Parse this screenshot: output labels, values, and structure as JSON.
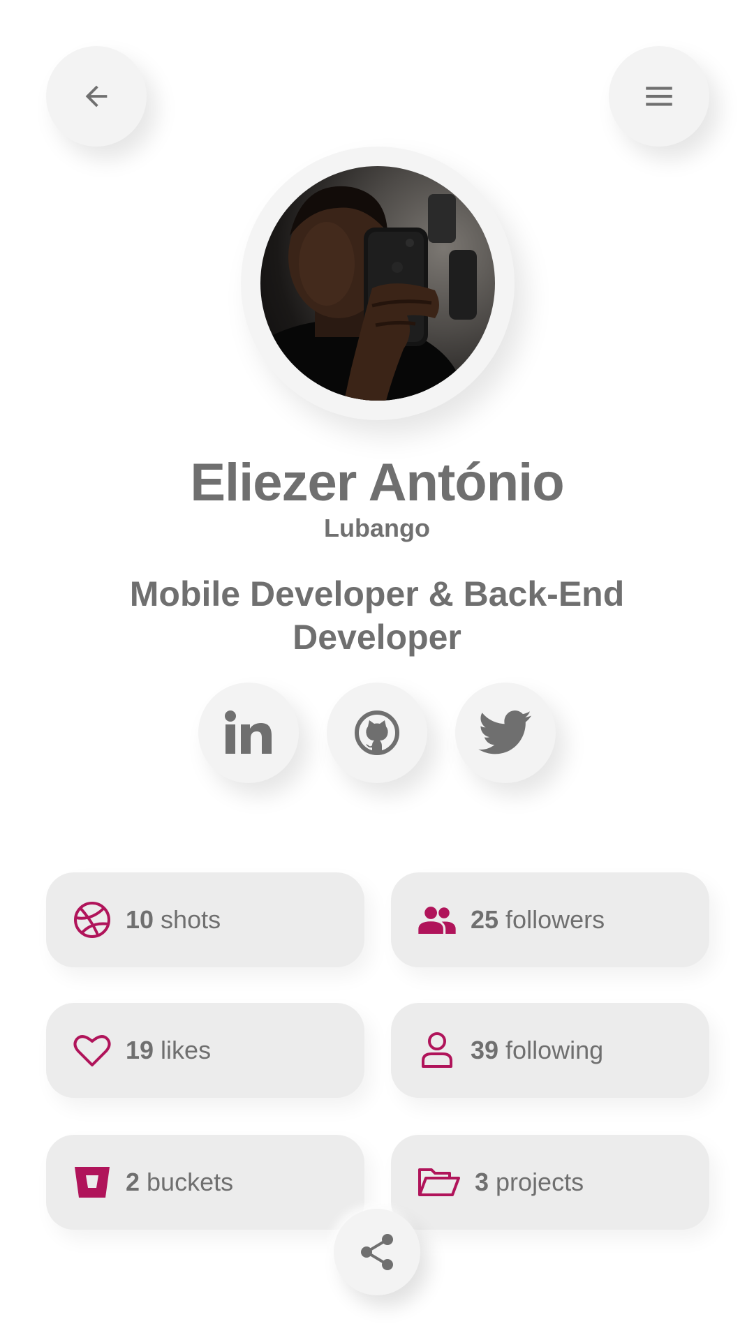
{
  "header": {
    "back_icon": "arrow-left-icon",
    "menu_icon": "hamburger-menu-icon"
  },
  "profile": {
    "name": "Eliezer António",
    "city": "Lubango",
    "role": "Mobile Developer & Back-End Developer"
  },
  "social": [
    {
      "icon": "linkedin-icon"
    },
    {
      "icon": "github-icon"
    },
    {
      "icon": "twitter-icon"
    }
  ],
  "stats": [
    {
      "value": "10",
      "label": "shots",
      "icon": "dribbble-icon"
    },
    {
      "value": "25",
      "label": "followers",
      "icon": "people-icon"
    },
    {
      "value": "19",
      "label": "likes",
      "icon": "heart-icon"
    },
    {
      "value": "39",
      "label": "following",
      "icon": "person-icon"
    },
    {
      "value": "2",
      "label": "buckets",
      "icon": "bucket-icon"
    },
    {
      "value": "3",
      "label": "projects",
      "icon": "folder-open-icon"
    }
  ],
  "share_icon": "share-icon",
  "colors": {
    "accent": "#b0145a",
    "text": "#6f6f6f",
    "background": "#ffffff",
    "card": "#ececec"
  }
}
